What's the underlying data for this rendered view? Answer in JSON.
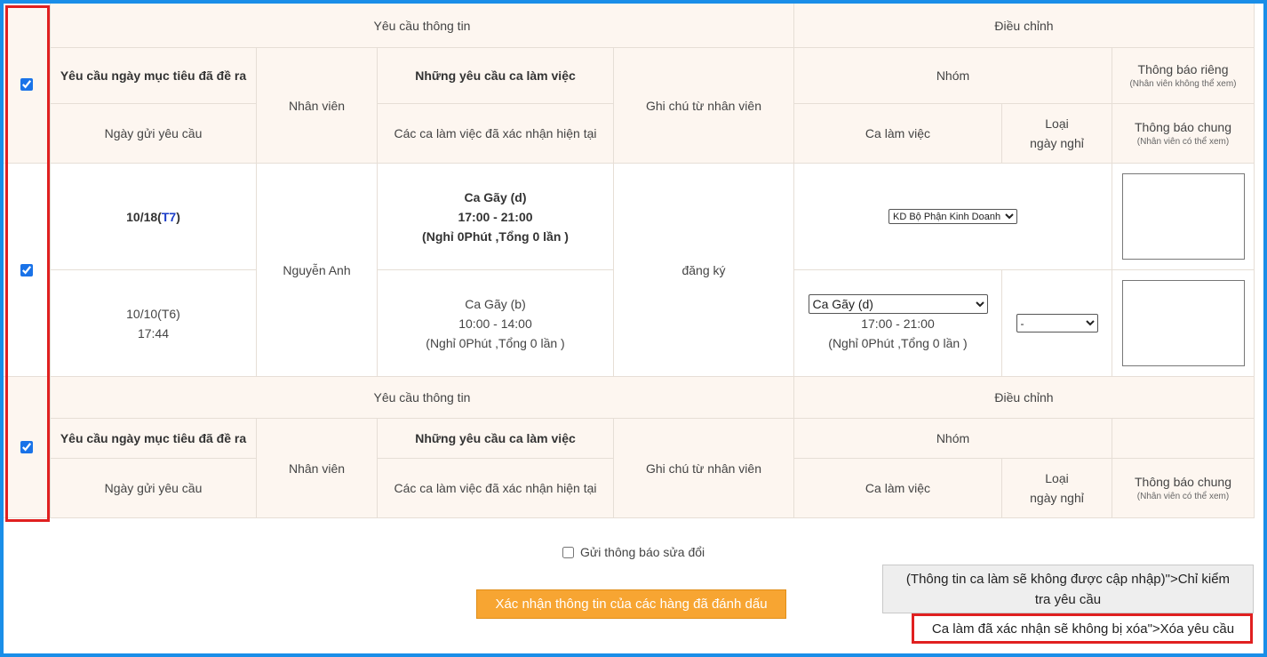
{
  "header": {
    "request_info": "Yêu cầu thông tin",
    "adjustment": "Điều chỉnh",
    "target_date": "Yêu cầu ngày mục tiêu đã đề ra",
    "send_date": "Ngày gửi yêu cầu",
    "employee": "Nhân viên",
    "shift_requests": "Những yêu cầu ca làm việc",
    "confirmed_shifts": "Các ca làm việc đã xác nhận hiện tại",
    "employee_note": "Ghi chú từ nhân viên",
    "group": "Nhóm",
    "private_notice": "Thông báo riêng",
    "private_notice_sub": "(Nhân viên không thể xem)",
    "shift": "Ca làm việc",
    "leave_type_1": "Loại",
    "leave_type_2": "ngày nghỉ",
    "public_notice": "Thông báo chung",
    "public_notice_sub": "(Nhân viên có thể xem)"
  },
  "row": {
    "target_date_prefix": "10/18(",
    "target_date_day": "T7",
    "target_date_suffix": ")",
    "send_date": "10/10(T6)",
    "send_time": "17:44",
    "employee": "Nguyễn Anh",
    "req_shift_name": "Ca Gãy (d)",
    "req_shift_time": "17:00 - 21:00",
    "req_shift_break": "(Nghỉ 0Phút ,Tổng 0 lần )",
    "cur_shift_name": "Ca Gãy (b)",
    "cur_shift_time": "10:00 - 14:00",
    "cur_shift_break": "(Nghỉ 0Phút ,Tổng 0 lần )",
    "note": "đăng ký",
    "group_select": "KD Bộ Phận Kinh Doanh",
    "shift_select": "Ca Gãy (d)",
    "adj_shift_time": "17:00 - 21:00",
    "adj_shift_break": "(Nghỉ 0Phút ,Tổng 0 lần )",
    "leave_select": "-"
  },
  "footer": {
    "send_notice_label": "Gửi thông báo sửa đổi",
    "confirm_button": "Xác nhận thông tin của các hàng đã đánh dấu",
    "check_only_button_1": "(Thông tin ca làm sẽ không được cập nhập)\">Chỉ kiểm",
    "check_only_button_2": "tra yêu cầu",
    "delete_button": "Ca làm đã xác nhận sẽ không bị xóa\">Xóa yêu cầu"
  },
  "colors": {
    "header_bg": "#fdf6f0",
    "frame_border": "#1a8ee8",
    "highlight_red": "#e02020",
    "confirm_orange": "#f7a532"
  }
}
